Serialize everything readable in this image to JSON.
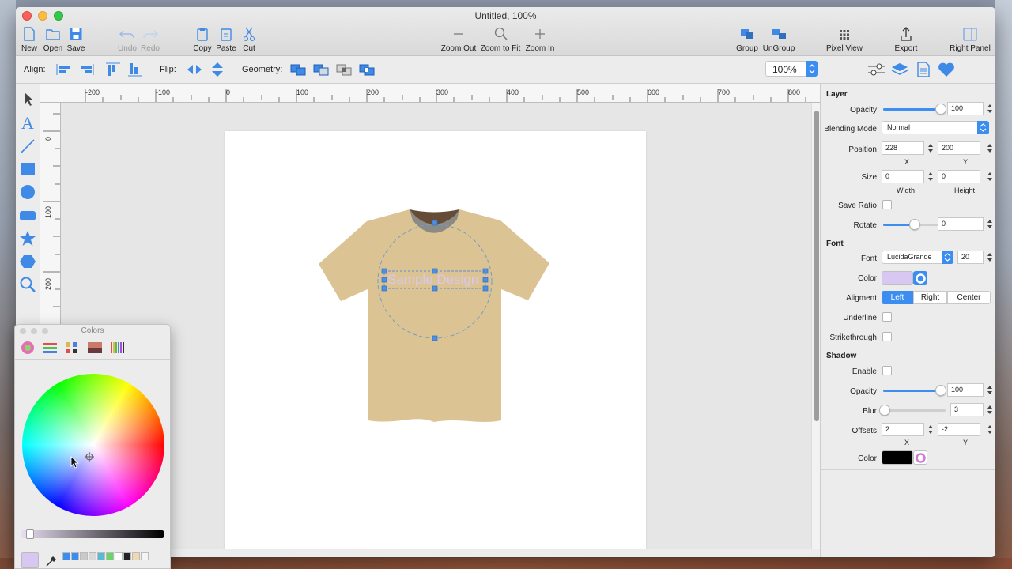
{
  "window": {
    "title": "Untitled, 100%"
  },
  "toolbar": {
    "new": "New",
    "open": "Open",
    "save": "Save",
    "undo": "Undo",
    "redo": "Redo",
    "copy": "Copy",
    "paste": "Paste",
    "cut": "Cut",
    "zoom_out": "Zoom Out",
    "zoom_fit": "Zoom to Fit",
    "zoom_in": "Zoom In",
    "group": "Group",
    "ungroup": "UnGroup",
    "pixel_view": "Pixel View",
    "export": "Export",
    "right_panel": "Right Panel"
  },
  "alignbar": {
    "align": "Align:",
    "flip": "Flip:",
    "geometry": "Geometry:",
    "zoom": "100%"
  },
  "ruler": {
    "top": [
      "-200",
      "-100",
      "0",
      "100",
      "200",
      "300",
      "400",
      "500",
      "600",
      "700",
      "800"
    ],
    "left": [
      "0",
      "100",
      "200"
    ]
  },
  "canvas": {
    "text": "Sample Design",
    "shirt_color": "#dcc394",
    "collar_color": "#654c37"
  },
  "panel": {
    "layer": {
      "title": "Layer",
      "opacity_label": "Opacity",
      "opacity": "100",
      "opacity_level": 1.0,
      "blending_label": "Blending Mode",
      "blending": "Normal",
      "position_label": "Position",
      "x": "228",
      "y": "200",
      "x_label": "X",
      "y_label": "Y",
      "size_label": "Size",
      "width": "0",
      "height": "0",
      "width_label": "Width",
      "height_label": "Height",
      "save_ratio_label": "Save Ratio",
      "rotate_label": "Rotate",
      "rotate": "0",
      "rotate_level": 0.5
    },
    "font": {
      "title": "Font",
      "font_label": "Font",
      "font": "LucidaGrande",
      "size": "20",
      "color_label": "Color",
      "color": "#d7c7f1",
      "alignment_label": "Aligment",
      "left": "Left",
      "right": "Right",
      "center": "Center",
      "underline_label": "Underline",
      "strikethrough_label": "Strikethrough"
    },
    "shadow": {
      "title": "Shadow",
      "enable_label": "Enable",
      "opacity_label": "Opacity",
      "opacity": "100",
      "opacity_level": 1.0,
      "blur_label": "Blur",
      "blur": "3",
      "blur_level": 0.03,
      "offsets_label": "Offsets",
      "x": "2",
      "y": "-2",
      "x_label": "X",
      "y_label": "Y",
      "color_label": "Color",
      "color": "#000000"
    }
  },
  "colors_panel": {
    "title": "Colors",
    "current": "#d7c7f1"
  }
}
